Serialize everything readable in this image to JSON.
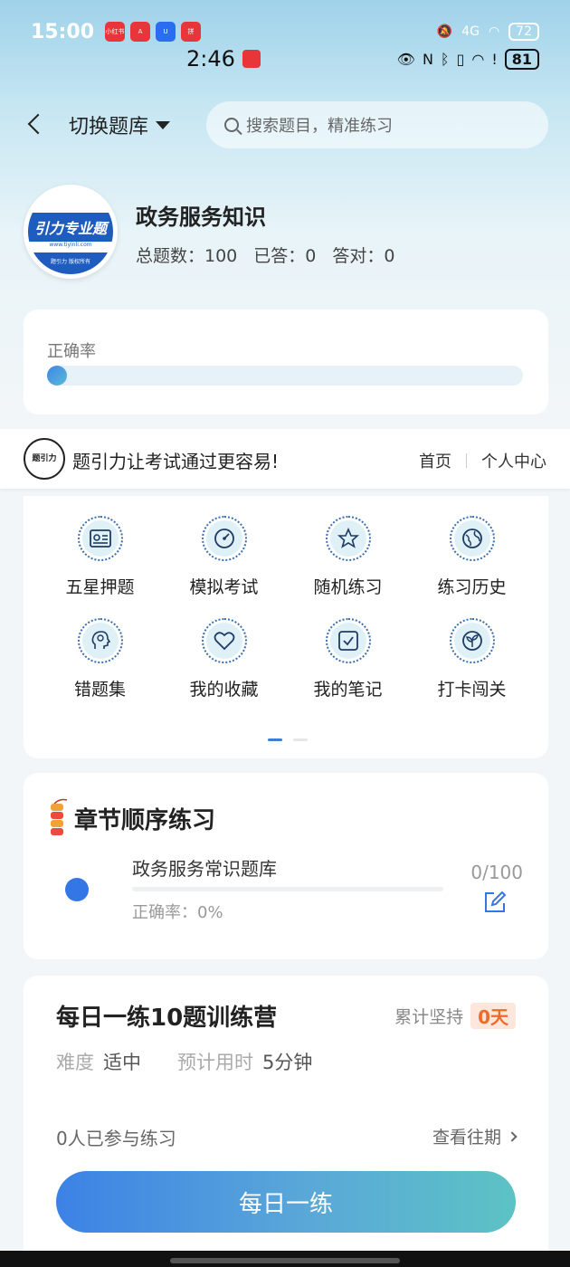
{
  "status": {
    "time": "15:00",
    "app_badges": [
      "小红书",
      "A",
      "U",
      "拼"
    ],
    "network": "4G",
    "battery": "72",
    "time2": "2:46",
    "battery2": "81"
  },
  "nav": {
    "switch_label": "切换题库",
    "search_placeholder": "搜索题目，精准练习"
  },
  "bank": {
    "logo_text": "引力专业题",
    "logo_url": "www.tiyinli.com",
    "logo_footer": "题引力 版权所有",
    "title": "政务服务知识",
    "total_label": "总题数：100",
    "answered_label": "已答：0",
    "correct_label": "答对：0"
  },
  "accuracy": {
    "label": "正确率",
    "value": 0
  },
  "ad": {
    "logo_text": "题引力",
    "slogan": "题引力让考试通过更容易!",
    "link_home": "首页",
    "link_profile": "个人中心"
  },
  "functions": [
    {
      "label": "五星押题",
      "icon": "id-card-icon"
    },
    {
      "label": "模拟考试",
      "icon": "gauge-icon"
    },
    {
      "label": "随机练习",
      "icon": "star-network-icon"
    },
    {
      "label": "练习历史",
      "icon": "globe-icon"
    },
    {
      "label": "错题集",
      "icon": "head-icon"
    },
    {
      "label": "我的收藏",
      "icon": "heart-icon"
    },
    {
      "label": "我的笔记",
      "icon": "checkbox-icon"
    },
    {
      "label": "打卡闯关",
      "icon": "sprout-icon"
    }
  ],
  "chapter": {
    "title": "章节顺序练习",
    "name": "政务服务常识题库",
    "accuracy": "正确率：0%",
    "count": "0/100"
  },
  "daily": {
    "title": "每日一练10题训练营",
    "streak_label": "累计坚持",
    "streak_value": "0天",
    "difficulty_label": "难度",
    "difficulty_value": "适中",
    "time_label": "预计用时",
    "time_value": "5分钟",
    "participants": "0人已参与练习",
    "past_label": "查看往期",
    "button_label": "每日一练"
  },
  "colors": {
    "accent": "#3476e5",
    "gradient_end": "#5cc3c4",
    "streak": "#f06a2a"
  }
}
